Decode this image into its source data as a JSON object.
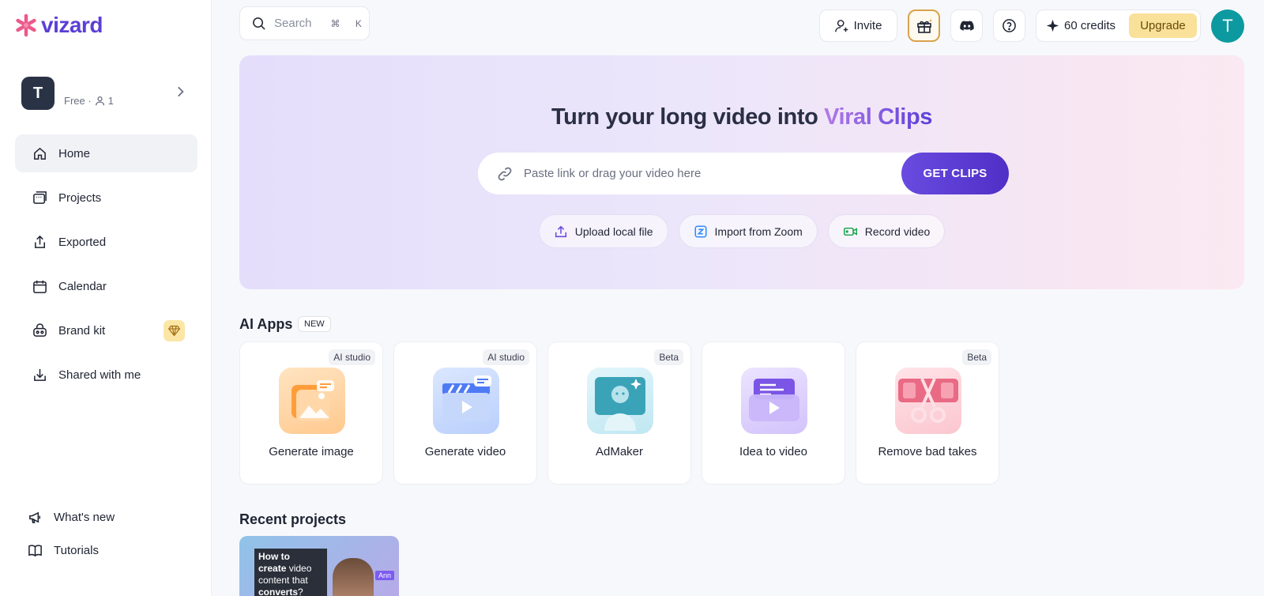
{
  "brand": {
    "name": "vizard"
  },
  "workspace": {
    "avatar_letter": "T",
    "plan": "Free · ",
    "members": "1"
  },
  "sidebar": {
    "items": [
      {
        "label": "Home",
        "icon": "home-icon"
      },
      {
        "label": "Projects",
        "icon": "projects-icon"
      },
      {
        "label": "Exported",
        "icon": "export-icon"
      },
      {
        "label": "Calendar",
        "icon": "calendar-icon"
      },
      {
        "label": "Brand kit",
        "icon": "brand-kit-icon"
      },
      {
        "label": "Shared with me",
        "icon": "shared-icon"
      }
    ],
    "bottom": [
      {
        "label": "What's new",
        "icon": "megaphone-icon"
      },
      {
        "label": "Tutorials",
        "icon": "book-icon"
      }
    ]
  },
  "topbar": {
    "search_placeholder": "Search",
    "search_shortcut": "⌘ K",
    "invite_label": "Invite",
    "credits_label": "60 credits",
    "upgrade_label": "Upgrade",
    "user_initial": "T"
  },
  "hero": {
    "title_main": "Turn your long video into ",
    "title_accent": "Viral Clips",
    "input_placeholder": "Paste link or drag your video here",
    "cta_label": "GET CLIPS",
    "imports": [
      {
        "label": "Upload local file",
        "icon": "upload-icon"
      },
      {
        "label": "Import from Zoom",
        "icon": "zoom-icon"
      },
      {
        "label": "Record video",
        "icon": "camera-icon"
      }
    ]
  },
  "ai_apps": {
    "title": "AI Apps",
    "badge": "NEW",
    "apps": [
      {
        "label": "Generate image",
        "tag": "AI studio"
      },
      {
        "label": "Generate video",
        "tag": "AI studio"
      },
      {
        "label": "AdMaker",
        "tag": "Beta"
      },
      {
        "label": "Idea to video",
        "tag": ""
      },
      {
        "label": "Remove bad takes",
        "tag": "Beta"
      }
    ]
  },
  "recent": {
    "title": "Recent projects",
    "thumb_line1": "How to",
    "thumb_line2a": "create",
    "thumb_line2b": " video",
    "thumb_line3": "content that",
    "thumb_line4a": "converts",
    "thumb_line4b": "?",
    "thumb_tag": "Ann"
  }
}
